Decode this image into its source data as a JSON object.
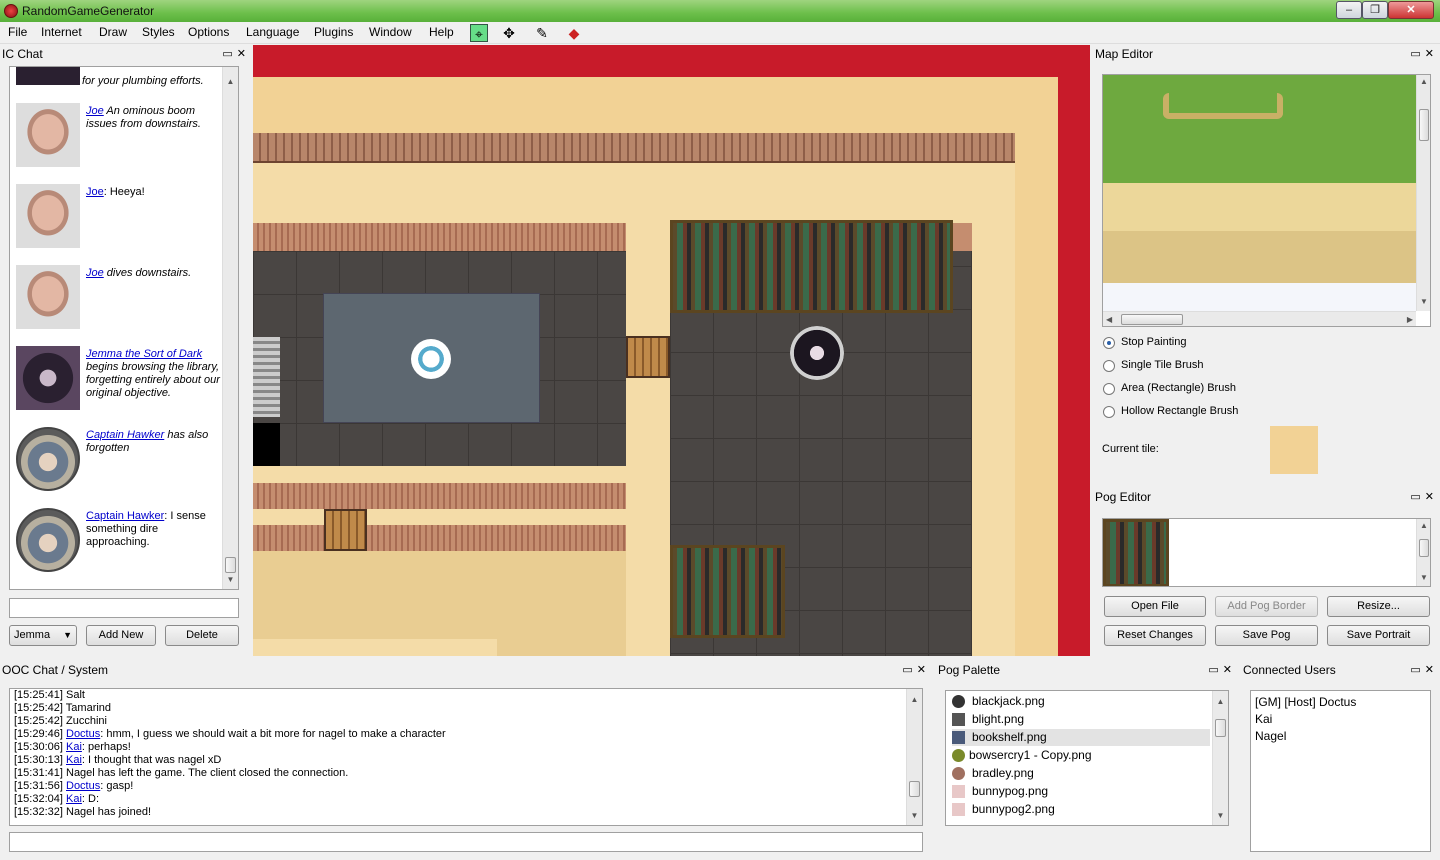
{
  "window": {
    "title": "RandomGameGenerator"
  },
  "menu": [
    "File",
    "Internet",
    "Draw",
    "Styles",
    "Options",
    "Language",
    "Plugins",
    "Window",
    "Help"
  ],
  "toolbar_icons": [
    "pointer-tool-icon",
    "move-tool-icon",
    "draw-tool-icon",
    "eraser-tool-icon"
  ],
  "ic_chat": {
    "title": "IC Chat",
    "top_fragment": "for your plumbing efforts.",
    "entries": [
      {
        "avatar": "face",
        "name": "Joe",
        "text": " An ominous boom issues from downstairs."
      },
      {
        "avatar": "face",
        "name": "Joe",
        "text": ": Heeya!"
      },
      {
        "avatar": "face",
        "name": "Joe",
        "text": " dives downstairs."
      },
      {
        "avatar": "dark",
        "name": "Jemma the Sort of Dark",
        "text": " begins browsing the library, forgetting entirely about our original objective."
      },
      {
        "avatar": "round",
        "name": "Captain Hawker",
        "text": " has also forgotten"
      },
      {
        "avatar": "round",
        "name": "Captain Hawker",
        "text": ": I sense something dire approaching."
      }
    ],
    "input_value": "",
    "character_select": "Jemma",
    "add_button": "Add New",
    "delete_button": "Delete"
  },
  "map_editor": {
    "title": "Map Editor",
    "brush_options": [
      {
        "label": "Stop Painting",
        "checked": true
      },
      {
        "label": "Single Tile Brush",
        "checked": false
      },
      {
        "label": "Area (Rectangle) Brush",
        "checked": false
      },
      {
        "label": "Hollow Rectangle Brush",
        "checked": false
      }
    ],
    "current_tile_label": "Current tile:",
    "current_tile_color": "#f2d295"
  },
  "pog_editor": {
    "title": "Pog Editor",
    "buttons": {
      "open_file": "Open File",
      "add_pog_border": "Add Pog Border",
      "resize": "Resize...",
      "reset_changes": "Reset Changes",
      "save_pog": "Save Pog",
      "save_portrait": "Save Portrait"
    }
  },
  "ooc_chat": {
    "title": "OOC Chat / System",
    "lines": [
      {
        "time": "[15:25:41]",
        "who": "",
        "text": " Salt"
      },
      {
        "time": "[15:25:42]",
        "who": "",
        "text": " Tamarind"
      },
      {
        "time": "[15:25:42]",
        "who": "",
        "text": " Zucchini"
      },
      {
        "time": "[15:29:46]",
        "who": "Doctus",
        "text": ": hmm, I guess we should wait a bit more for nagel to make a character"
      },
      {
        "time": "[15:30:06]",
        "who": "Kai",
        "text": ": perhaps!"
      },
      {
        "time": "[15:30:13]",
        "who": "Kai",
        "text": ": I thought that was nagel xD"
      },
      {
        "time": "[15:31:41]",
        "who": "",
        "text": " Nagel has left the game. The client closed the connection."
      },
      {
        "time": "[15:31:56]",
        "who": "Doctus",
        "text": ": gasp!"
      },
      {
        "time": "[15:32:04]",
        "who": "Kai",
        "text": ": D:"
      },
      {
        "time": "[15:32:32]",
        "who": "",
        "text": " Nagel has joined!"
      }
    ],
    "input_value": ""
  },
  "pog_palette": {
    "title": "Pog Palette",
    "items": [
      {
        "name": "blackjack.png",
        "color": "#333"
      },
      {
        "name": "blight.png",
        "color": "#555"
      },
      {
        "name": "bookshelf.png",
        "color": "#4a5a7a"
      },
      {
        "name": "bowsercry1 - Copy.png",
        "color": "#7a8a2a"
      },
      {
        "name": "bradley.png",
        "color": "#a07060"
      },
      {
        "name": "bunnypog.png",
        "color": "#e8c8c8"
      },
      {
        "name": "bunnypog2.png",
        "color": "#e8c8c8"
      }
    ],
    "selected": "bookshelf.png"
  },
  "connected_users": {
    "title": "Connected Users",
    "users": [
      "[GM] [Host] Doctus",
      "Kai",
      "Nagel"
    ]
  }
}
